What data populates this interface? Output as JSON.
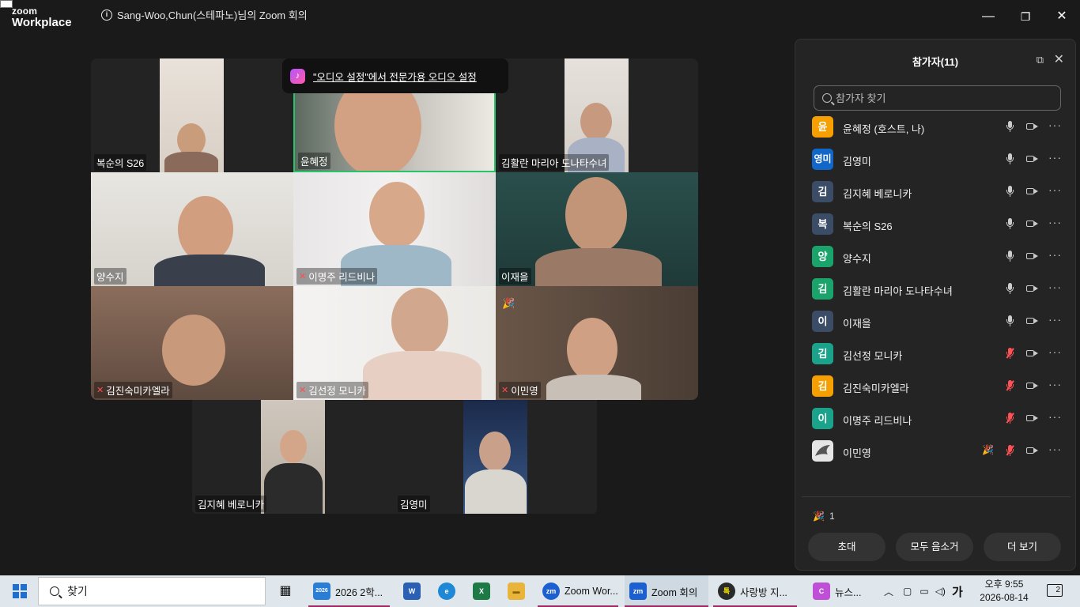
{
  "window": {
    "logo_top": "zoom",
    "logo_bottom": "Workplace",
    "meeting_title": "Sang-Woo,Chun(스테파노)님의 Zoom 회의",
    "minimize": "—",
    "restore": "❐",
    "close": "✕"
  },
  "toast": {
    "text": "\"오디오 설정\"에서 전문가용 오디오 설정"
  },
  "gallery": {
    "tiles": [
      {
        "name": "복순의 S26",
        "muted": false
      },
      {
        "name": "윤혜정",
        "muted": false,
        "active": true
      },
      {
        "name": "김활란 마리아 도나타수녀",
        "muted": false
      },
      {
        "name": "양수지",
        "muted": false
      },
      {
        "name": "이명주 리드비나",
        "muted": true
      },
      {
        "name": "이재을",
        "muted": false
      },
      {
        "name": "김진숙미카엘라",
        "muted": true
      },
      {
        "name": "김선정 모니카",
        "muted": true
      },
      {
        "name": "이민영",
        "muted": true,
        "reaction": "🎉"
      },
      {
        "name": "김지혜 베로니카",
        "muted": false
      },
      {
        "name": "김영미",
        "muted": false
      }
    ],
    "mic_off_symbol": "✕"
  },
  "panel": {
    "title": "참가자(11)",
    "popout": "⧉",
    "close": "✕",
    "search_placeholder": "참가자 찾기",
    "participants": [
      {
        "avatar": "윤",
        "color": "#f5a000",
        "name": "윤혜정 (호스트, 나)",
        "muted": false
      },
      {
        "avatar": "영미",
        "color": "#1266c8",
        "name": "김영미",
        "muted": false
      },
      {
        "avatar": "김",
        "color": "#3b4c66",
        "name": "김지혜 베로니카",
        "muted": false
      },
      {
        "avatar": "복",
        "color": "#3b4c66",
        "name": "복순의 S26",
        "muted": false
      },
      {
        "avatar": "양",
        "color": "#1aa36a",
        "name": "양수지",
        "muted": false
      },
      {
        "avatar": "김",
        "color": "#1aa36a",
        "name": "김활란 마리아 도나타수녀",
        "muted": false
      },
      {
        "avatar": "이",
        "color": "#3b4c66",
        "name": "이재을",
        "muted": false
      },
      {
        "avatar": "김",
        "color": "#1aa38a",
        "name": "김선정 모니카",
        "muted": true
      },
      {
        "avatar": "김",
        "color": "#f5a000",
        "name": "김진숙미카엘라",
        "muted": true
      },
      {
        "avatar": "이",
        "color": "#1aa38a",
        "name": "이명주 리드비나",
        "muted": true
      },
      {
        "avatar": "",
        "color": "#e6e6e6",
        "name": "이민영",
        "muted": true,
        "reaction": "🎉"
      }
    ],
    "more_symbol": "···",
    "reaction_icon": "🎉",
    "reaction_count": "1",
    "buttons": {
      "invite": "초대",
      "mute_all": "모두 음소거",
      "more": "더 보기"
    }
  },
  "taskbar": {
    "search_label": "찾기",
    "items": [
      {
        "icon": "▦",
        "color": "#2a2a2a",
        "label": ""
      },
      {
        "icon": "2026",
        "color": "#2a7ed6",
        "label": "2026 2학..."
      },
      {
        "icon": "W",
        "color": "#2b5fb3",
        "label": ""
      },
      {
        "icon": "e",
        "color": "#1e88d6",
        "label": ""
      },
      {
        "icon": "X",
        "color": "#1e7a45",
        "label": ""
      },
      {
        "icon": "▬",
        "color": "#e8b43a",
        "label": ""
      },
      {
        "icon": "zm",
        "color": "#1b5fd1",
        "label": "Zoom Wor..."
      },
      {
        "icon": "zm",
        "color": "#1b5fd1",
        "label": "Zoom 회의"
      },
      {
        "icon": "톡",
        "color": "#2a2a2a",
        "label": "사랑방 지..."
      },
      {
        "icon": "C",
        "color": "#c04fd8",
        "label": "뉴스..."
      }
    ],
    "tray_chevron": "︿",
    "tray_ime": "가",
    "clock_time": "오후 9:55",
    "clock_date": "2026-08-14",
    "notif_count": "2"
  }
}
